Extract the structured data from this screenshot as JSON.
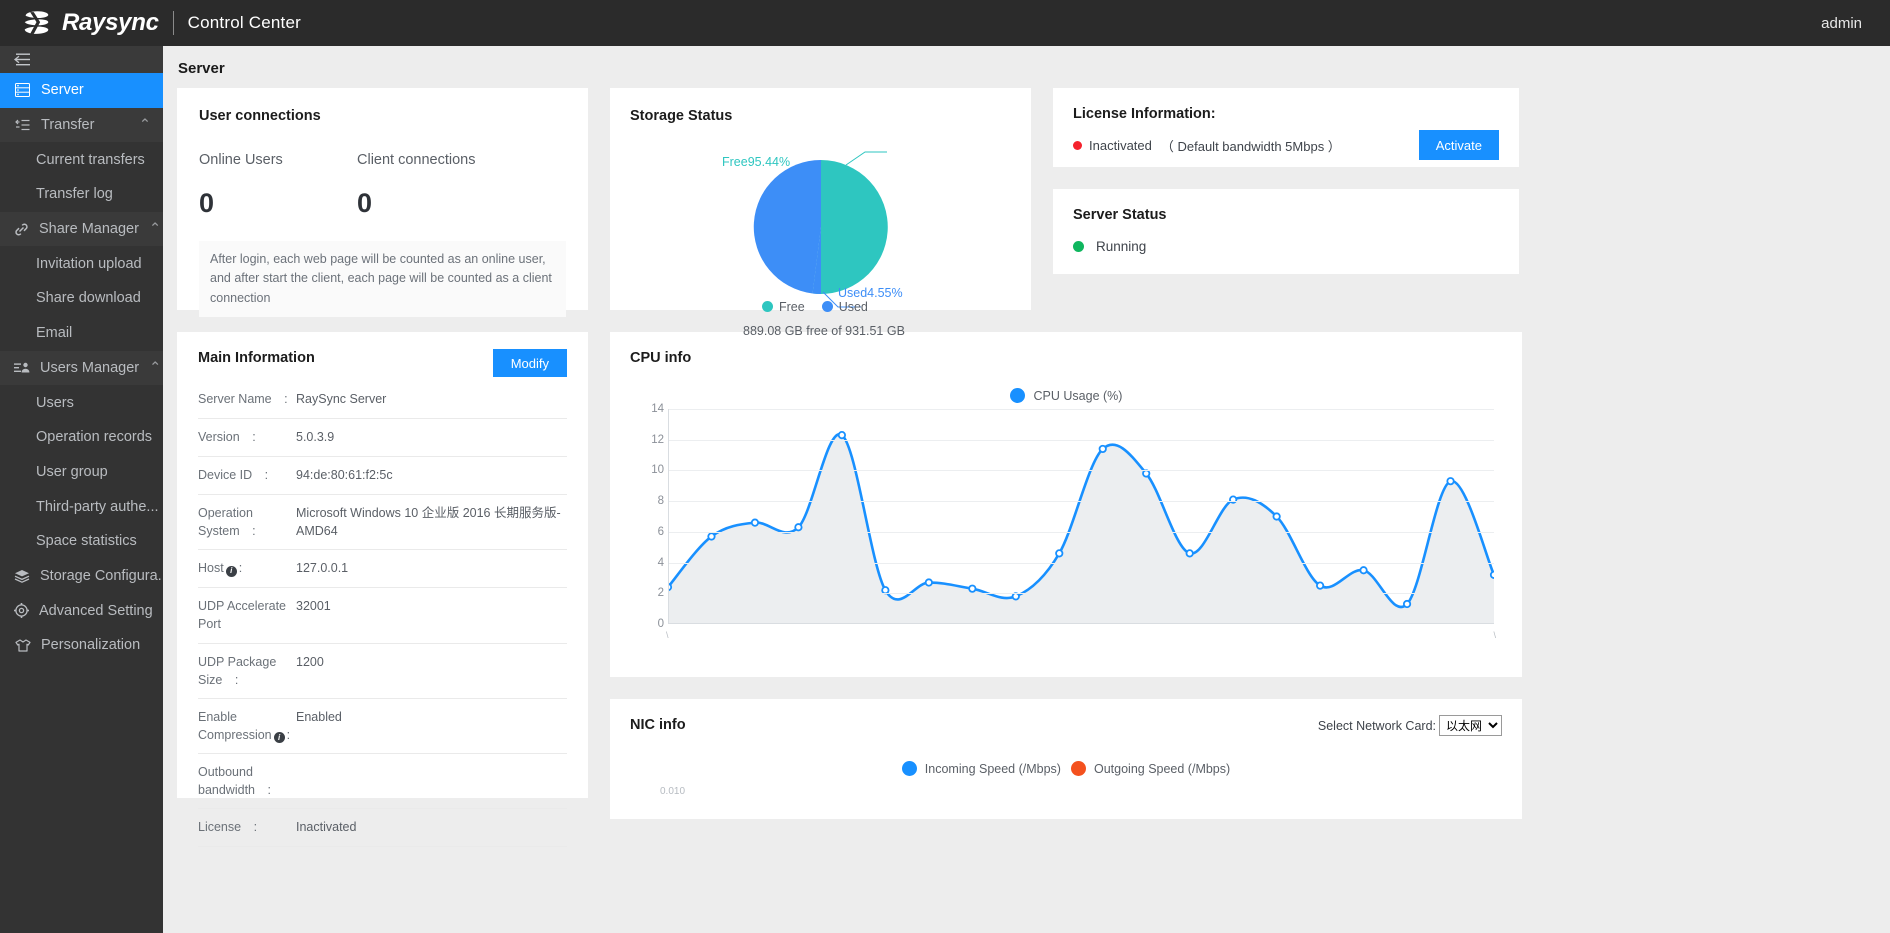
{
  "topbar": {
    "brand": "Raysync",
    "subtitle": "Control Center",
    "user": "admin",
    "logo_icon": "raysync-logo-icon"
  },
  "sidebar": {
    "collapse_icon": "collapse-menu-icon",
    "items": [
      {
        "label": "Server",
        "icon": "server-icon",
        "type": "active"
      },
      {
        "label": "Transfer",
        "icon": "transfer-icon",
        "type": "group",
        "caret": "⌃"
      },
      {
        "label": "Current transfers",
        "icon": "",
        "type": "sub"
      },
      {
        "label": "Transfer log",
        "icon": "",
        "type": "sub"
      },
      {
        "label": "Share Manager",
        "icon": "link-icon",
        "type": "group",
        "caret": "⌃"
      },
      {
        "label": "Invitation upload",
        "icon": "",
        "type": "sub"
      },
      {
        "label": "Share download",
        "icon": "",
        "type": "sub"
      },
      {
        "label": "Email",
        "icon": "",
        "type": "sub"
      },
      {
        "label": "Users Manager",
        "icon": "users-icon",
        "type": "group",
        "caret": "⌃"
      },
      {
        "label": "Users",
        "icon": "",
        "type": "sub"
      },
      {
        "label": "Operation records",
        "icon": "",
        "type": "sub"
      },
      {
        "label": "User group",
        "icon": "",
        "type": "sub"
      },
      {
        "label": "Third-party authe...",
        "icon": "",
        "type": "sub"
      },
      {
        "label": "Space statistics",
        "icon": "",
        "type": "sub"
      },
      {
        "label": "Storage Configura...",
        "icon": "layers-icon",
        "type": "item"
      },
      {
        "label": "Advanced Setting",
        "icon": "gear-icon",
        "type": "item",
        "caret": "⌄"
      },
      {
        "label": "Personalization",
        "icon": "shirt-icon",
        "type": "item"
      }
    ]
  },
  "page": {
    "title": "Server"
  },
  "user_connections": {
    "title": "User connections",
    "online_users_label": "Online Users",
    "online_users_value": "0",
    "client_connections_label": "Client connections",
    "client_connections_value": "0",
    "note": "After login, each web page will be counted as an online user, and after start the client, each page will be counted as a client connection"
  },
  "storage_status": {
    "title": "Storage Status",
    "free_label": "Free95.44%",
    "used_label": "Used4.55%",
    "legend_free": "Free",
    "legend_used": "Used",
    "footer": "889.08 GB free of 931.51 GB",
    "color_free": "#2ec6c0",
    "color_used": "#3d8ef7"
  },
  "license": {
    "title": "License Information:",
    "status": "Inactivated",
    "detail": "（ Default bandwidth 5Mbps ）",
    "activate_label": "Activate",
    "status_color": "#f5222d"
  },
  "server_status": {
    "title": "Server Status",
    "state": "Running",
    "state_color": "#0fb65e"
  },
  "main_information": {
    "title": "Main Information",
    "modify_label": "Modify",
    "rows": [
      {
        "key": "Server Name :",
        "value": "RaySync Server"
      },
      {
        "key": "Version :",
        "value": "5.0.3.9"
      },
      {
        "key": "Device ID :",
        "value": "94:de:80:61:f2:5c"
      },
      {
        "key": "Operation System :",
        "value": "Microsoft Windows 10 企业版 2016 长期服务版-AMD64"
      },
      {
        "key": "Host",
        "value": "127.0.0.1",
        "info": true,
        "suffix": ":"
      },
      {
        "key": "UDP Accelerate Port",
        "value": "32001"
      },
      {
        "key": "UDP Package Size :",
        "value": "1200"
      },
      {
        "key": "Enable Compression",
        "value": "Enabled",
        "info": true,
        "suffix": ":"
      },
      {
        "key": "Outbound bandwidth :",
        "value": ""
      },
      {
        "key": "License :",
        "value": "Inactivated"
      }
    ]
  },
  "nic_info": {
    "title": "NIC info",
    "select_label": "Select Network Card:",
    "selected_option": "以太网",
    "options": [
      "以太网"
    ],
    "legend_in": "Incoming Speed (/Mbps)",
    "legend_out": "Outgoing Speed (/Mbps)",
    "color_in": "#1890ff",
    "color_out": "#f4511e",
    "y_first_tick": "0.010"
  },
  "chart_data": [
    {
      "type": "pie",
      "title": "Storage Status",
      "labels": [
        "Free",
        "Used"
      ],
      "values": [
        95.44,
        4.55
      ],
      "colors": [
        "#2ec6c0",
        "#3d8ef7"
      ],
      "annotations": [
        "Free95.44%",
        "Used4.55%"
      ],
      "footer": "889.08 GB free of 931.51 GB",
      "legend_position": "bottom"
    },
    {
      "type": "area",
      "title": "CPU info",
      "legend": [
        "CPU Usage (%)"
      ],
      "series": [
        {
          "name": "CPU Usage (%)",
          "color": "#1890ff",
          "values": [
            2.4,
            5.7,
            6.6,
            6.3,
            12.3,
            2.2,
            2.7,
            2.3,
            1.8,
            4.6,
            11.4,
            9.8,
            4.6,
            8.1,
            7.0,
            2.5,
            3.5,
            1.3,
            9.3,
            3.2
          ]
        }
      ],
      "ylabel": "",
      "xlabel": "",
      "ylim": [
        0,
        14
      ],
      "yticks": [
        0,
        2,
        4,
        6,
        8,
        10,
        12,
        14
      ],
      "grid": true,
      "legend_position": "top-center"
    },
    {
      "type": "line",
      "title": "NIC info",
      "legend": [
        "Incoming Speed (/Mbps)",
        "Outgoing Speed (/Mbps)"
      ],
      "colors": [
        "#1890ff",
        "#f4511e"
      ],
      "series": [
        {
          "name": "Incoming Speed (/Mbps)",
          "values": []
        },
        {
          "name": "Outgoing Speed (/Mbps)",
          "values": []
        }
      ],
      "yticks": [
        0.01
      ],
      "legend_position": "top-center"
    }
  ]
}
